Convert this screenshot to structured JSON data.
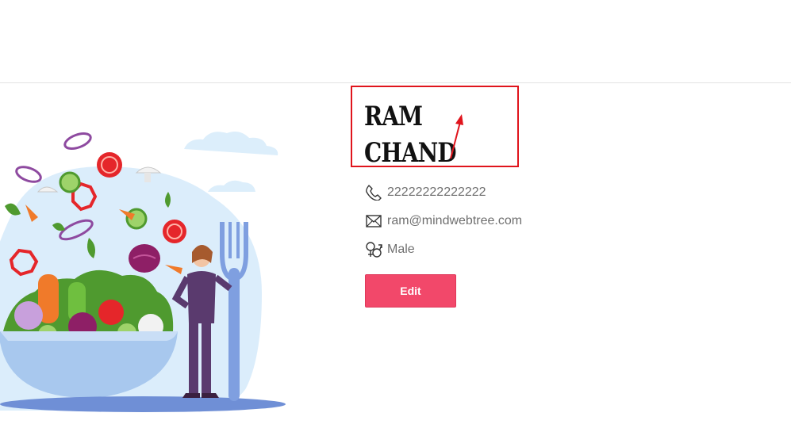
{
  "profile": {
    "name_line1": "RAM",
    "name_line2": "CHAND",
    "phone": "22222222222222",
    "email": "ram@mindwebtree.com",
    "gender": "Male"
  },
  "actions": {
    "edit_label": "Edit"
  },
  "icons": {
    "phone": "phone-icon",
    "email": "envelope-icon",
    "gender": "gender-icon"
  },
  "colors": {
    "edit_button": "#f2486a",
    "annotation": "#e0141c",
    "text_muted": "#6f6f6f"
  }
}
